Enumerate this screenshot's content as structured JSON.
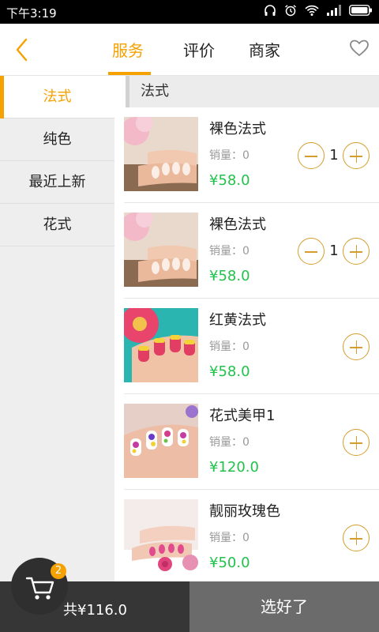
{
  "status_bar": {
    "time": "下午3:19",
    "icons": [
      "headphones-icon",
      "alarm-icon",
      "wifi-icon",
      "signal-icon",
      "battery-icon"
    ]
  },
  "header": {
    "tabs": [
      {
        "label": "服务",
        "active": true
      },
      {
        "label": "评价",
        "active": false
      },
      {
        "label": "商家",
        "active": false
      }
    ],
    "back_icon": "chevron-left-icon",
    "favorite_icon": "heart-outline-icon"
  },
  "categories": [
    {
      "label": "法式",
      "active": true
    },
    {
      "label": "纯色",
      "active": false
    },
    {
      "label": "最近上新",
      "active": false
    },
    {
      "label": "花式",
      "active": false
    }
  ],
  "section_title": "法式",
  "items": [
    {
      "name": "裸色法式",
      "sales": "销量：0",
      "price": "¥58.0",
      "quantity": "1",
      "image": "nude-french-nails"
    },
    {
      "name": "裸色法式",
      "sales": "销量：0",
      "price": "¥58.0",
      "quantity": "1",
      "image": "nude-french-nails"
    },
    {
      "name": "红黄法式",
      "sales": "销量：0",
      "price": "¥58.0",
      "quantity": "",
      "image": "red-yellow-french-nails"
    },
    {
      "name": "花式美甲1",
      "sales": "销量：0",
      "price": "¥120.0",
      "quantity": "",
      "image": "floral-nail-art"
    },
    {
      "name": "靓丽玫瑰色",
      "sales": "销量：0",
      "price": "¥50.0",
      "quantity": "",
      "image": "rose-pink-nails"
    }
  ],
  "cart": {
    "badge_count": "2",
    "total": "共¥116.0",
    "confirm_label": "选好了"
  },
  "colors": {
    "accent": "#f5a100",
    "price": "#21c24b",
    "bottom_left": "#363636",
    "bottom_right": "#6b6b6b"
  }
}
